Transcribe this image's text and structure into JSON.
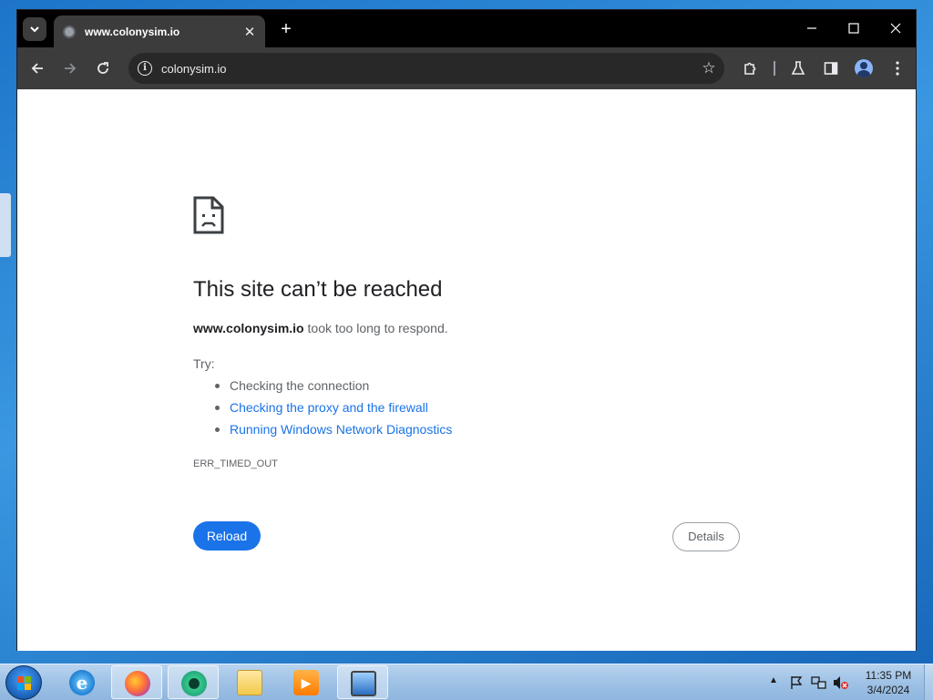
{
  "browser": {
    "tab_title": "www.colonysim.io",
    "url": "colonysim.io"
  },
  "error_page": {
    "title": "This site can’t be reached",
    "host": "www.colonysim.io",
    "desc_rest": " took too long to respond.",
    "try_label": "Try:",
    "suggestions": [
      {
        "text": "Checking the connection"
      },
      {
        "text": "Checking the proxy and the firewall"
      },
      {
        "text": "Running Windows Network Diagnostics"
      }
    ],
    "error_code": "ERR_TIMED_OUT",
    "reload_label": "Reload",
    "details_label": "Details"
  },
  "taskbar": {
    "time": "11:35 PM",
    "date": "3/4/2024"
  },
  "colors": {
    "link": "#1a73e8",
    "reload_button": "#1a73e8",
    "toolbar": "#3c3c3c",
    "tabstrip": "#000000"
  }
}
